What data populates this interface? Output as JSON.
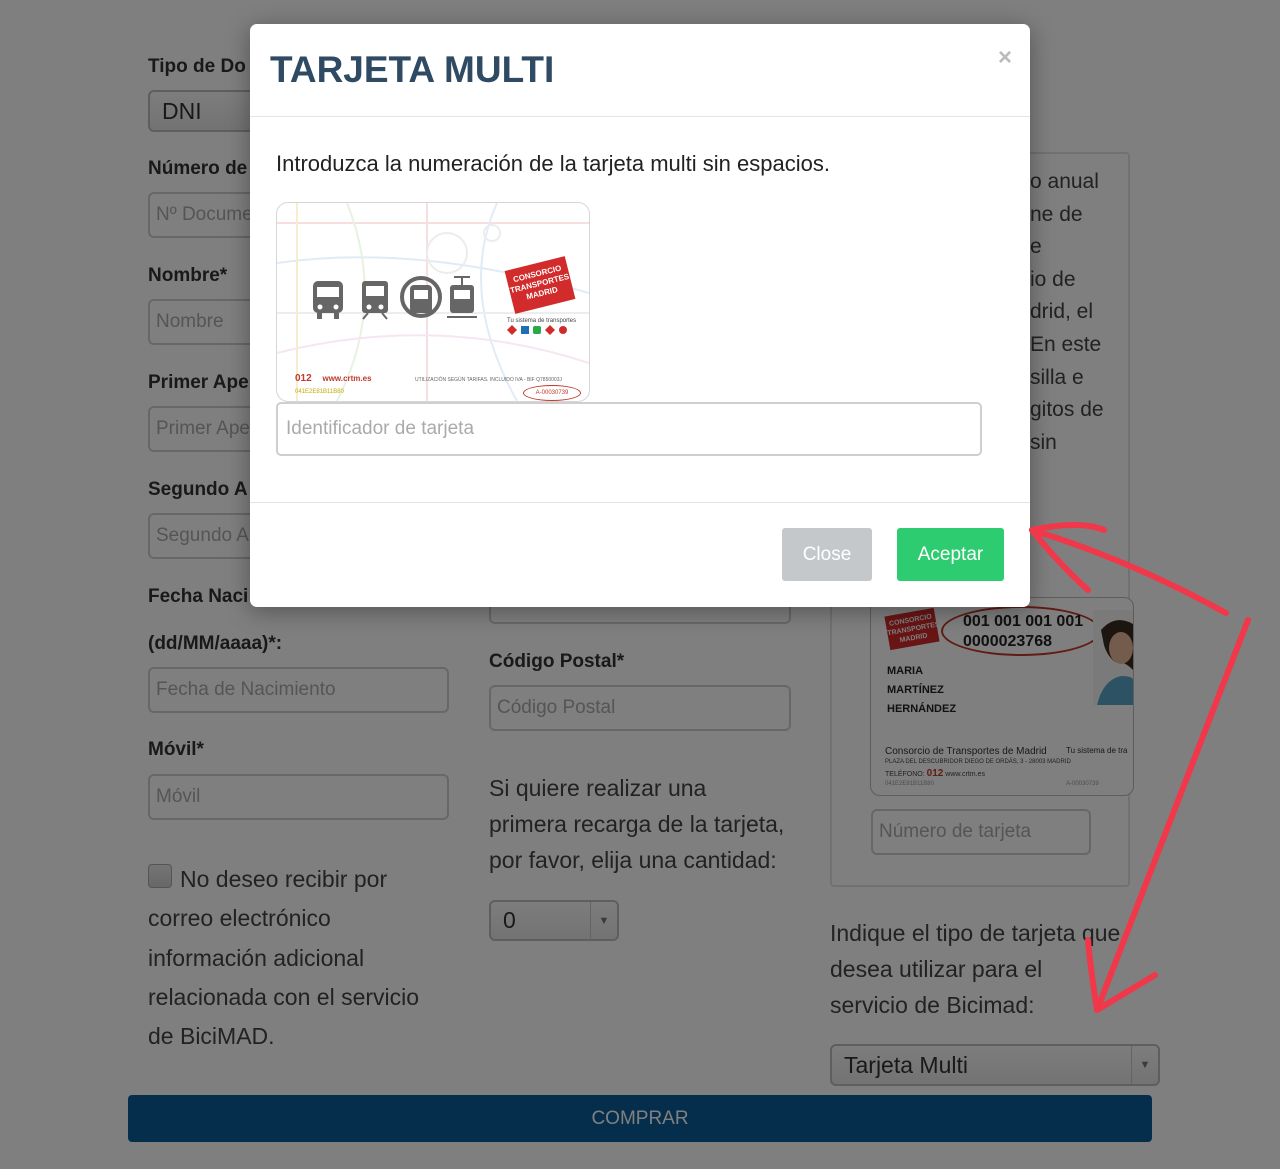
{
  "form": {
    "doc_type_label": "Tipo de Do",
    "doc_type_value": "DNI",
    "doc_number_label": "Número de",
    "doc_number_placeholder": "Nº Docume",
    "name_label": "Nombre*",
    "name_placeholder": "Nombre",
    "first_surname_label": "Primer Ape",
    "first_surname_placeholder": "Primer Ape",
    "second_surname_label": "Segundo A",
    "second_surname_placeholder": "Segundo A",
    "birthdate_label_1": "Fecha Naci",
    "birthdate_label_2": "(dd/MM/aaaa)*:",
    "birthdate_placeholder": "Fecha de Nacimiento",
    "mobile_label": "Móvil*",
    "mobile_placeholder": "Móvil",
    "postal_label": "Código Postal*",
    "postal_placeholder": "Código Postal",
    "recharge_lines": [
      "Si quiere realizar una",
      "primera recarga de la tarjeta,",
      "por favor, elija una cantidad:"
    ],
    "recharge_value": "0",
    "newsletter_lines": [
      "No deseo recibir por",
      "correo electrónico",
      "información adicional",
      "relacionada con el servicio",
      "de BiciMAD."
    ],
    "card_type_lines": [
      "Indique el tipo de tarjeta que",
      "desea utilizar para el",
      "servicio de Bicimad:"
    ],
    "card_type_value": "Tarjeta Multi",
    "submit_label": "COMPRAR"
  },
  "info_panel": {
    "lines": [
      "o anual",
      "ne de",
      "e",
      "io de",
      "drid, el",
      "En este",
      "silla e",
      "gitos de",
      "sin"
    ],
    "card_number_placeholder": "Número de tarjeta",
    "card_example": {
      "logo": "CONSORCIO TRANSPORTES MADRID",
      "number_line1": "001 001 001 001",
      "number_line2": "0000023768",
      "holder": [
        "MARIA",
        "MARTÍNEZ",
        "HERNÁNDEZ"
      ],
      "ctm": "Consorcio de Transportes de Madrid",
      "address": "PLAZA DEL DESCUBRIDOR DIEGO DE ORDÁS, 3 - 28003 MADRID",
      "phone_prefix": "TELÉFONO:",
      "phone": "012",
      "web": "www.crtm.es",
      "system": "Tu sistema de tra",
      "code": "041E2E81B11B80",
      "serial": "A-00030739"
    }
  },
  "modal": {
    "title": "TARJETA MULTI",
    "close_symbol": "×",
    "description": "Introduzca la numeración de la tarjeta multi sin espacios.",
    "input_placeholder": "Identificador de tarjeta",
    "close_button": "Close",
    "accept_button": "Aceptar",
    "card_image": {
      "logo": "CONSORCIO TRANSPORTES MADRID",
      "system": "Tu sistema de transportes",
      "phone": "012",
      "web": "www.crtm.es",
      "util": "UTILIZACIÓN SEGÚN TARIFAS. INCLUIDO IVA - BIF Q7850003J",
      "code": "041E2E81B11B80",
      "serial": "A-00030739"
    }
  },
  "colors": {
    "title": "#2f4a63",
    "accept": "#2ecc71",
    "close": "#c4c8cb",
    "submit": "#0b5d9a",
    "arrow": "#f0384a"
  }
}
